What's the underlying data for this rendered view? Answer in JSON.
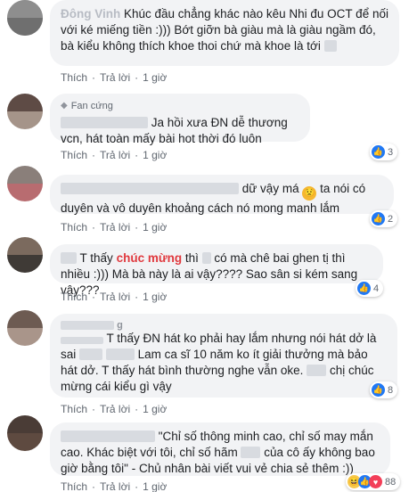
{
  "comments": [
    {
      "name": "Đông Vinh",
      "text_1": "Khúc đầu chẳng khác nào kêu Nhi đu OCT để nối với ké miếng tiền :))) Bớt giỡn bà giàu mà là giàu ngầm đó, bà kiểu không thích khoe thoi chứ mà khoe là tới",
      "like": "Thích",
      "reply": "Trả lời",
      "time": "1 giờ"
    },
    {
      "badge": "Fan cứng",
      "text_1": "Ja hồi xưa ĐN dễ thương vcn, hát toàn mấy bài hot thời đó luôn",
      "like": "Thích",
      "reply": "Trả lời",
      "time": "1 giờ",
      "reaction_count": "3"
    },
    {
      "text_1": "dữ vậy má",
      "text_2": "ta nói có duyên và vô duyên khoảng cách nó mong manh lắm",
      "like": "Thích",
      "reply": "Trả lời",
      "time": "1 giờ",
      "reaction_count": "2"
    },
    {
      "text_1": "T thấy",
      "highlight": "chúc mừng",
      "text_2": "thì",
      "text_3": "có mà chê bai ghen tị thì nhiều :))) Mà bà này là ai vậy???? Sao sân si kém sang vậy???",
      "like": "Thích",
      "reply": "Trả lời",
      "time": "1 giờ",
      "reaction_count": "4"
    },
    {
      "name": "g",
      "text_1": "T thấy ĐN hát ko phải hay lắm nhưng nói hát dở là sai",
      "text_2": "Lam ca sĩ 10 năm ko ít giải thưởng mà bảo hát dở. T thấy hát bình thường nghe vẫn oke.",
      "text_3": "chị chúc mừng cái kiểu gì vậy",
      "like": "Thích",
      "reply": "Trả lời",
      "time": "1 giờ",
      "reaction_count": "8"
    },
    {
      "text_1": "\"Chỉ số thông minh cao, chỉ số may mắn cao. Khác biệt với tôi, chỉ số hãm",
      "text_2": "của cô ấy không bao giờ bằng tôi\" - Chủ nhân bài viết vui vẻ chia sẻ thêm :))",
      "like": "Thích",
      "reply": "Trả lời",
      "time": "1 giờ",
      "reaction_count": "88"
    }
  ],
  "colors": {
    "bubble": "#f2f3f5",
    "link": "#385898",
    "like_blue": "#2078f4",
    "highlight_red": "#e0393e"
  }
}
